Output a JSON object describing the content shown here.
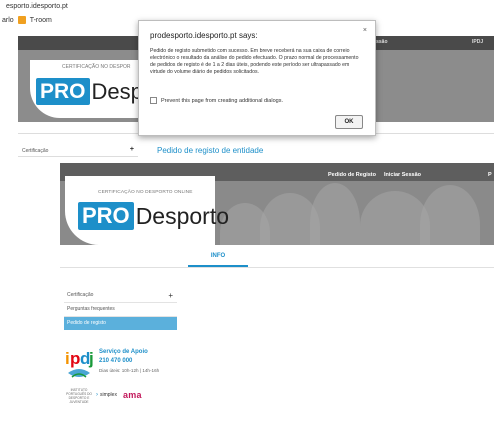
{
  "browser": {
    "address": "esporto.idesporto.pt",
    "bookmarks_prefix": "arlo",
    "bookmark_label": "T-room"
  },
  "top_page": {
    "nav_fragment": "Sessão",
    "nav_right": "IPDJ",
    "logo_caption": "CERTIFICAÇÃO NO DESPOR",
    "logo_pro": "PRO",
    "logo_desporto": "Despo",
    "sidebar_item": "Certificação",
    "sidebar_plus": "+",
    "page_title": "Pedido de registo de entidade"
  },
  "dialog": {
    "title": "prodesporto.idesporto.pt says:",
    "close_glyph": "×",
    "message": "Pedido de registo submetido com sucesso. Em breve receberá na sua caixa de correio electrónico o resultado da análise do pedido efectuado. O prazo normal de processamento de pedidos de registo é de 1 a 2 dias úteis, podendo este período ser ultrapassado em virtude do volume diário de pedidos solicitados.",
    "checkbox_label": "Prevent this page from creating additional dialogs.",
    "ok_label": "OK"
  },
  "page": {
    "nav": {
      "pedido_registo": "Pedido de Registo",
      "iniciar_sessao": "Iniciar Sessão",
      "edge": "P"
    },
    "logo_caption": "CERTIFICAÇÃO NO DESPORTO ONLINE",
    "logo_pro": "PRO",
    "logo_desporto": "Desporto",
    "tab_info": "INFO",
    "sidebar": {
      "items": [
        {
          "label": "Certificação",
          "plus": "+"
        },
        {
          "label": "Perguntas frequentes"
        },
        {
          "label": "Pedido de registo"
        }
      ]
    },
    "support": {
      "title": "Serviço de Apoio",
      "phone": "210 470 000",
      "hours": "Dias úteis: 10h-12h | 14h-16h",
      "ipdj_caption": "INSTITUTO PORTUGUÊS DO DESPORTO E JUVENTUDE",
      "simplex": "simplex",
      "ama": "ama"
    },
    "colors": {
      "accent": "#1d8fc9",
      "active_item": "#5bb0dc"
    }
  }
}
